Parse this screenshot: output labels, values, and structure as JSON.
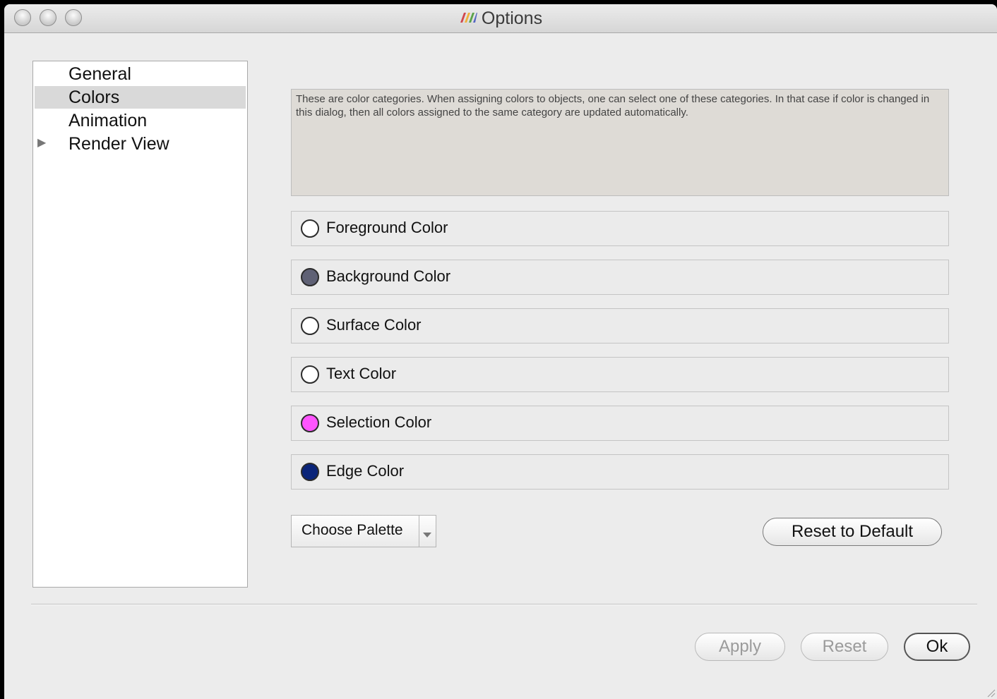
{
  "window": {
    "title": "Options"
  },
  "sidebar": {
    "items": [
      {
        "label": "General"
      },
      {
        "label": "Colors"
      },
      {
        "label": "Animation"
      },
      {
        "label": "Render View"
      }
    ],
    "selected": "Colors"
  },
  "description": "These are color categories. When assigning colors to objects, one can select one of these categories. In that case if color is changed in this dialog, then all colors assigned to the same category are updated automatically.",
  "colors": [
    {
      "label": "Foreground Color",
      "color": "#ffffff"
    },
    {
      "label": "Background Color",
      "color": "#5f6175"
    },
    {
      "label": "Surface Color",
      "color": "#ffffff"
    },
    {
      "label": "Text Color",
      "color": "#ffffff"
    },
    {
      "label": "Selection Color",
      "color": "#ff55ff"
    },
    {
      "label": "Edge Color",
      "color": "#0a2479"
    }
  ],
  "palette": {
    "label": "Choose Palette"
  },
  "buttons": {
    "reset_default": "Reset to Default",
    "apply": "Apply",
    "reset": "Reset",
    "ok": "Ok"
  }
}
